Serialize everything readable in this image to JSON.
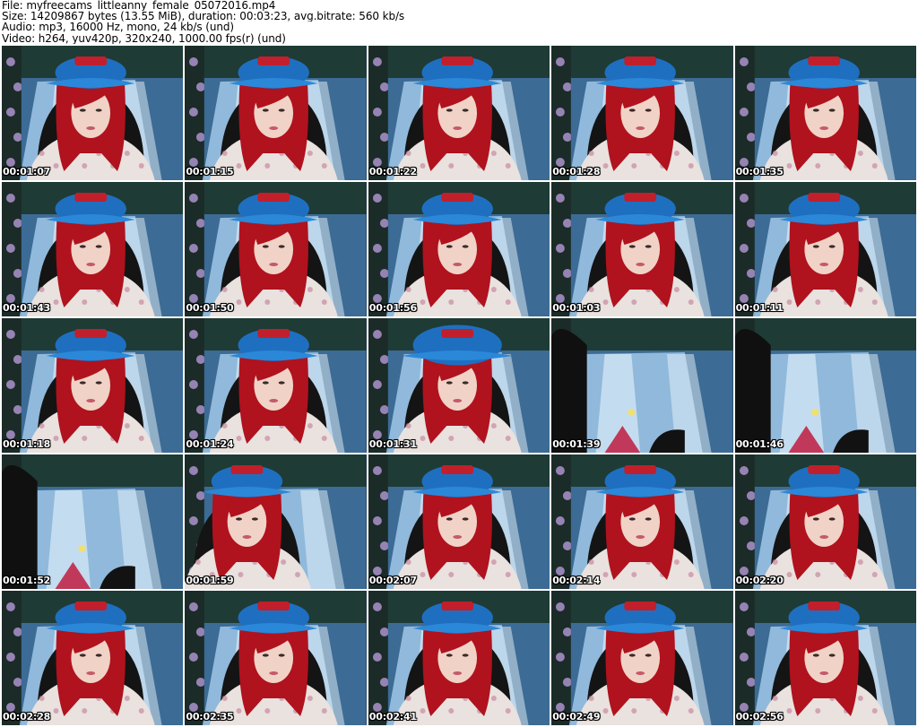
{
  "header": {
    "file": "File: myfreecams_littleanny_female_05072016.mp4",
    "size": "Size: 14209867 bytes (13.55 MiB), duration: 00:03:23, avg.bitrate: 560 kb/s",
    "audio": "Audio: mp3, 16000 Hz, mono, 24 kb/s (und)",
    "video": "Video: h264, yuv420p, 320x240, 1000.00 fps(r) (und)"
  },
  "thumbnails": [
    {
      "time": "00:01:07",
      "scene": "portrait"
    },
    {
      "time": "00:01:15",
      "scene": "portrait"
    },
    {
      "time": "00:01:22",
      "scene": "portrait"
    },
    {
      "time": "00:01:28",
      "scene": "portrait"
    },
    {
      "time": "00:01:35",
      "scene": "portrait"
    },
    {
      "time": "00:01:43",
      "scene": "portrait"
    },
    {
      "time": "00:01:50",
      "scene": "portrait"
    },
    {
      "time": "00:01:56",
      "scene": "portrait"
    },
    {
      "time": "00:01:03",
      "scene": "portrait"
    },
    {
      "time": "00:01:11",
      "scene": "portrait"
    },
    {
      "time": "00:01:18",
      "scene": "portrait"
    },
    {
      "time": "00:01:24",
      "scene": "portrait"
    },
    {
      "time": "00:01:31",
      "scene": "closeup"
    },
    {
      "time": "00:01:39",
      "scene": "empty"
    },
    {
      "time": "00:01:46",
      "scene": "empty"
    },
    {
      "time": "00:01:52",
      "scene": "empty"
    },
    {
      "time": "00:01:59",
      "scene": "moving"
    },
    {
      "time": "00:02:07",
      "scene": "portrait"
    },
    {
      "time": "00:02:14",
      "scene": "portrait"
    },
    {
      "time": "00:02:20",
      "scene": "portrait"
    },
    {
      "time": "00:02:28",
      "scene": "portrait"
    },
    {
      "time": "00:02:35",
      "scene": "portrait"
    },
    {
      "time": "00:02:41",
      "scene": "portrait"
    },
    {
      "time": "00:02:49",
      "scene": "portrait"
    },
    {
      "time": "00:02:56",
      "scene": "portrait"
    }
  ],
  "colors": {
    "cap": "#1f6fc0",
    "hair": "#b0121e",
    "waterfall": "#9fc7e8",
    "shirt": "#e9e2df",
    "background": "#22324f"
  }
}
